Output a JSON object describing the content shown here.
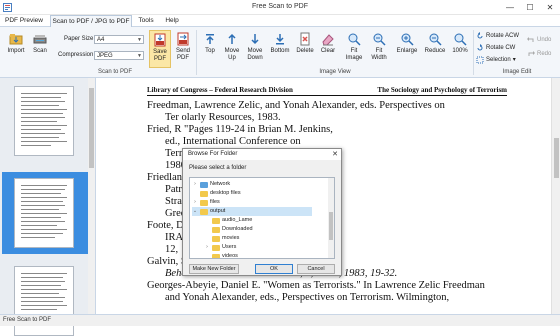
{
  "window": {
    "title": "Free Scan to PDF",
    "minimize": "—",
    "maximize": "☐",
    "close": "✕"
  },
  "menu": [
    "PDF Preview",
    "Scan to PDF / JPG to PDF",
    "Tools",
    "Help"
  ],
  "ribbon": {
    "import": "Import",
    "scan": "Scan",
    "paper_size_label": "Paper Size",
    "paper_size_value": "A4",
    "compression_label": "Compression",
    "compression_value": "JPEG",
    "save_pdf": [
      "Save",
      "PDF"
    ],
    "send_pdf": [
      "Send",
      "PDF"
    ],
    "group_scan": "Scan to PDF",
    "top": "Top",
    "move_up": [
      "Move",
      "Up"
    ],
    "move_down": [
      "Move",
      "Down"
    ],
    "bottom": "Bottom",
    "delete": "Delete",
    "clear": "Clear",
    "fit_image": [
      "Fit",
      "Image"
    ],
    "fit_width": [
      "Fit",
      "Width"
    ],
    "enlarge": "Enlarge",
    "reduce": "Reduce",
    "zoom": "100%",
    "group_view": "Image View",
    "rotate_acw": "Rotate ACW",
    "rotate_cw": "Rotate CW",
    "selection": "Selection",
    "undo": "Undo",
    "redo": "Redo",
    "group_edit": "Image Edit"
  },
  "document": {
    "header_left": "Library of Congress – Federal Research Division",
    "header_right": "The Sociology and Psychology of Terrorism",
    "lines": [
      "Freedman, Lawrence Zelic, and Yonah Alexander, eds. Perspectives on",
      "Ter                                                  olarly Resources, 1983.",
      "Fried, R                                                \"Pages 119-24 in Brian M. Jenkins,",
      "ed.,                                                    International Conference on",
      "Terr                                                   Santa Monica, California: Rand,",
      "1980",
      "Friedlan                                              rrorism: Contemporary Views.\" In",
      "Patr                                                   ds., Managing Terrorism:",
      "Stra                                                  se. Westport, Connecticut:",
      "Gree",
      "Foote, D                                              nsider Describes the Workings of the",
      "IRA                                                    ganization,\" Newsweek, September",
      "12,",
      "Galvin,                                                Socio-Psychological Perspective,\"",
      "Behavioral Science and the Law, 1, No. 1, 1983, 19-32.",
      "Georges-Abeyie, Daniel E. \"Women as Terrorists.\" In Lawrence Zelic Freedman",
      "and Yonah Alexander, eds., Perspectives on Terrorism. Wilmington,"
    ]
  },
  "dialog": {
    "title": "Browse For Folder",
    "prompt": "Please select a folder",
    "tree": [
      {
        "label": "Network",
        "expander": "›",
        "icon": "network-icon"
      },
      {
        "label": "desktop files",
        "expander": "",
        "icon": "folder-icon"
      },
      {
        "label": "files",
        "expander": "›",
        "icon": "folder-icon"
      },
      {
        "label": "output",
        "expander": "⌄",
        "icon": "folder-icon",
        "selected": true
      },
      {
        "label": "audio_Lame",
        "expander": "",
        "icon": "folder-icon"
      },
      {
        "label": "Downloaded",
        "expander": "",
        "icon": "folder-icon"
      },
      {
        "label": "movies",
        "expander": "",
        "icon": "folder-icon"
      },
      {
        "label": "Users",
        "expander": "›",
        "icon": "folder-icon"
      },
      {
        "label": "videos",
        "expander": "",
        "icon": "folder-icon"
      }
    ],
    "new_folder": "Make New Folder",
    "ok": "OK",
    "cancel": "Cancel",
    "close": "✕"
  },
  "status": "Free Scan to PDF",
  "colors": {
    "accent": "#3b8de0",
    "highlight": "#fbe7a6",
    "ribbon_bg": "#f3f6fa"
  }
}
